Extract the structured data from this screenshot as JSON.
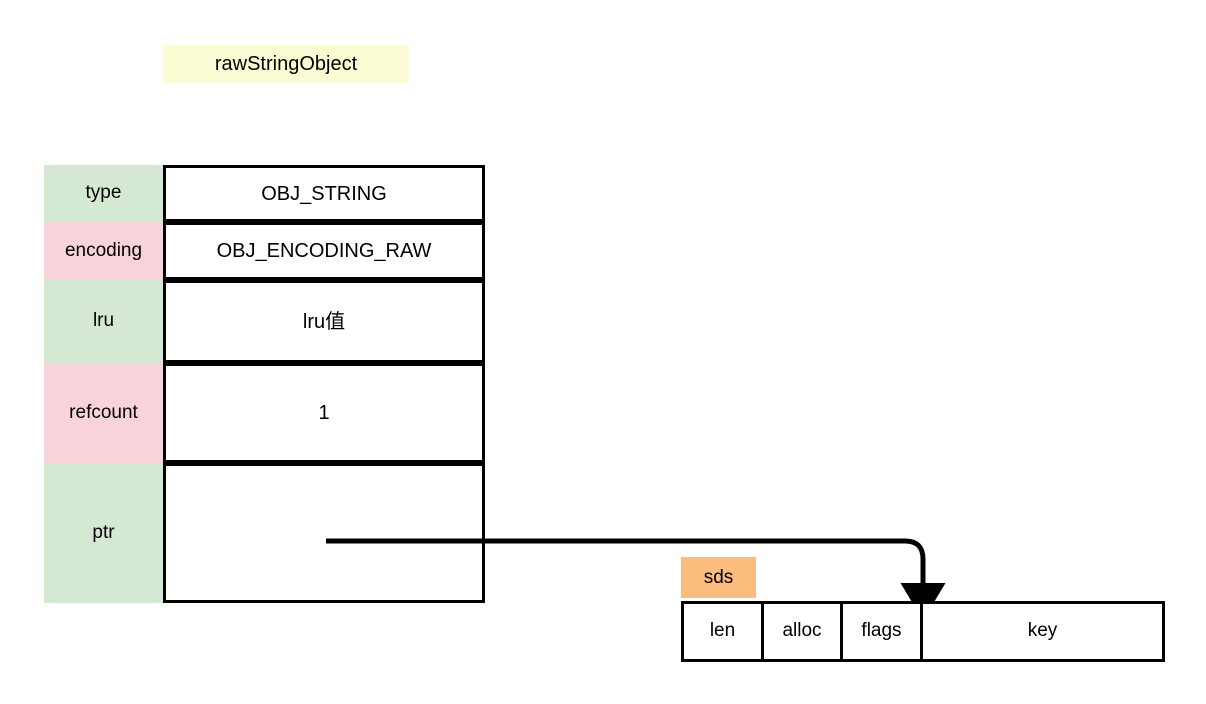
{
  "diagram": {
    "title_badge": "rawStringObject",
    "object_struct": {
      "rows": [
        {
          "label": "type",
          "value": "OBJ_STRING",
          "label_color": "#d5e8d4"
        },
        {
          "label": "encoding",
          "value": "OBJ_ENCODING_RAW",
          "label_color": "#f8d3d9"
        },
        {
          "label": "lru",
          "value": "lru值",
          "label_color": "#d5e8d4"
        },
        {
          "label": "refcount",
          "value": "1",
          "label_color": "#f8d3d9"
        },
        {
          "label": "ptr",
          "value": "",
          "label_color": "#d5e8d4"
        }
      ]
    },
    "sds": {
      "badge": "sds",
      "badge_color": "#fbbc7d",
      "cells": [
        {
          "label": "len"
        },
        {
          "label": "alloc"
        },
        {
          "label": "flags"
        },
        {
          "label": "key"
        }
      ]
    },
    "pointer_arrow": {
      "from": "ptr",
      "to": "sds-key-field",
      "color": "#000000"
    },
    "colors": {
      "highlight_yellow": "#fbfbd4",
      "label_green": "#d5e8d4",
      "label_pink": "#f8d3d9",
      "sds_orange": "#fbbc7d",
      "stroke": "#000000",
      "background": "#ffffff"
    }
  }
}
